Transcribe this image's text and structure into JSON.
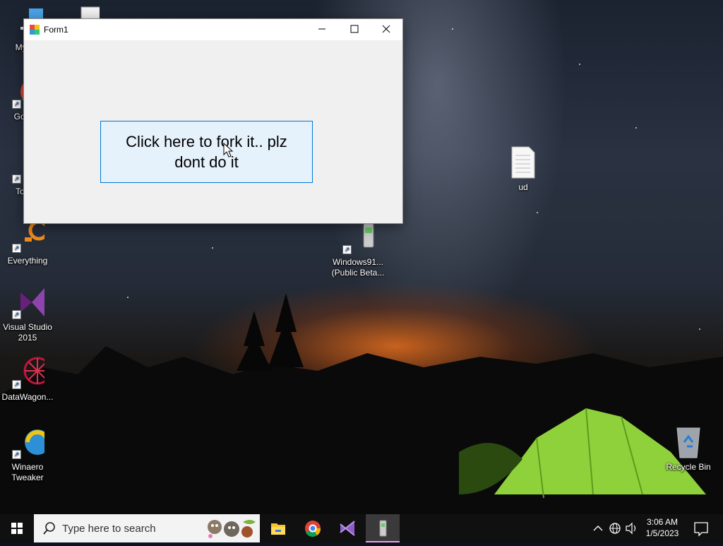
{
  "window": {
    "title": "Form1",
    "button_label": "Click here to fork it.. plz dont do it"
  },
  "desktop_icons": [
    {
      "label": "My Co",
      "icon": "computer-icon"
    },
    {
      "label": "Go Chr",
      "icon": "chrome-icon"
    },
    {
      "label": "Torren",
      "icon": "torrent-icon"
    },
    {
      "label": "Everything",
      "icon": "everything-icon"
    },
    {
      "label": "Visual Studio 2015",
      "icon": "visual-studio-icon"
    },
    {
      "label": "DataWagon...",
      "icon": "datawagon-icon"
    },
    {
      "label": "Winaero Tweaker",
      "icon": "winaero-icon"
    },
    {
      "label": "ud",
      "icon": "text-file-icon"
    },
    {
      "label": "Windows91... (Public Beta...",
      "icon": "phone-app-icon"
    },
    {
      "label": "Recycle Bin",
      "icon": "recycle-bin-icon"
    }
  ],
  "taskbar": {
    "search_placeholder": "Type here to search",
    "apps": [
      "file-explorer-icon",
      "chrome-icon",
      "visual-studio-icon",
      "phone-app-icon"
    ],
    "time": "3:06 AM",
    "date": "1/5/2023"
  },
  "colors": {
    "button_bg": "#e5f1fb",
    "button_border": "#0078d7",
    "taskbar": "#101010",
    "active_indicator": "#ee9fe8"
  }
}
